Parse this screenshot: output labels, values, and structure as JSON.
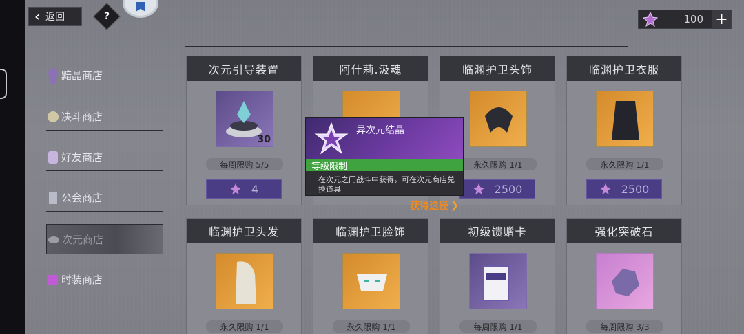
{
  "header": {
    "back_label": "返回",
    "help_label": "?",
    "currency_amount": "100",
    "plus_label": "+"
  },
  "sidebar": {
    "items": [
      {
        "label": "黯晶商店",
        "icon": "crystal-icon"
      },
      {
        "label": "决斗商店",
        "icon": "duel-icon"
      },
      {
        "label": "好友商店",
        "icon": "friend-icon"
      },
      {
        "label": "公会商店",
        "icon": "guild-icon"
      },
      {
        "label": "次元商店",
        "icon": "dimension-icon",
        "active": true
      },
      {
        "label": "时装商店",
        "icon": "fashion-icon"
      }
    ]
  },
  "cards": [
    {
      "name": "次元引导装置",
      "limit": "每周限购 5/5",
      "price": "4",
      "qty": "30"
    },
    {
      "name": "阿什莉.汲魂",
      "limit": "",
      "price": ""
    },
    {
      "name": "临渊护卫头饰",
      "limit": "永久限购 1/1",
      "price": "2500"
    },
    {
      "name": "临渊护卫衣服",
      "limit": "永久限购 1/1",
      "price": "2500"
    },
    {
      "name": "临渊护卫头发",
      "limit": "永久限购 1/1"
    },
    {
      "name": "临渊护卫脸饰",
      "limit": "永久限购 1/1"
    },
    {
      "name": "初级馈赠卡",
      "limit": "每周限购 1/1"
    },
    {
      "name": "强化突破石",
      "limit": "每周限购 3/3"
    }
  ],
  "tooltip": {
    "title": "异次元结晶",
    "level_label": "等级限制",
    "description": "在次元之门战斗中获得，可在次元商店兑换道具",
    "link_label": "获得途径"
  },
  "colors": {
    "accent_purple": "#4b3c86",
    "level_green": "#3fa33f",
    "link_orange": "#f08a1e"
  }
}
